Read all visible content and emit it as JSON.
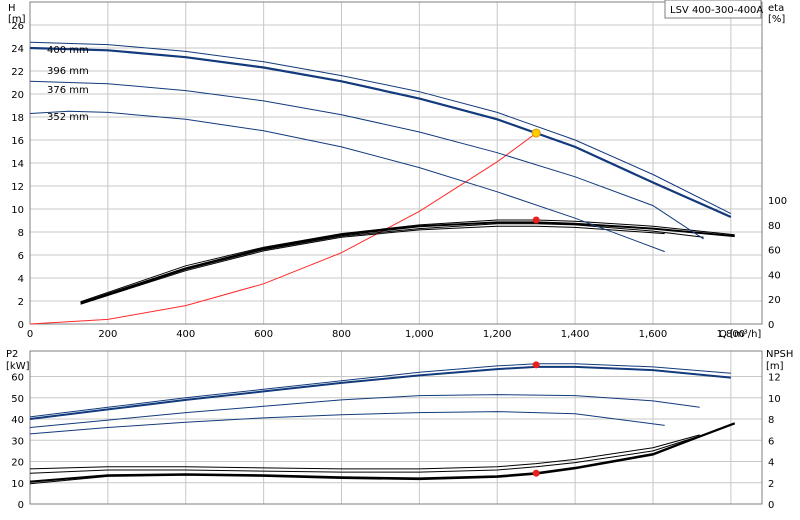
{
  "chart_data": [
    {
      "type": "line",
      "id": "head_eta",
      "title_box": "LSV 400-300-400A",
      "x_label": "Q [m³/h]",
      "x_ticks": [
        0,
        200,
        400,
        600,
        800,
        1000,
        1200,
        1400,
        1600,
        1800
      ],
      "x_tick_labels": [
        "0",
        "200",
        "400",
        "600",
        "800",
        "1,000",
        "1,200",
        "1,400",
        "1,600",
        "1,800"
      ],
      "xlim": [
        0,
        1880
      ],
      "left_axis": {
        "label_top": "H",
        "label_unit": "[m]",
        "ylim": [
          0,
          28
        ],
        "ticks": [
          0,
          2,
          4,
          6,
          8,
          10,
          12,
          14,
          16,
          18,
          20,
          22,
          24,
          26
        ]
      },
      "right_axis": {
        "label_top": "eta",
        "label_unit": "[%]",
        "ylim": [
          0,
          260
        ],
        "ticks": [
          0,
          20,
          40,
          60,
          80,
          100
        ]
      },
      "grid": true,
      "head_curves": [
        {
          "name": "400 mm",
          "x": [
            0,
            200,
            400,
            600,
            800,
            1000,
            1200,
            1400,
            1600,
            1800
          ],
          "y": [
            24.5,
            24.3,
            23.7,
            22.8,
            21.6,
            20.2,
            18.4,
            16.0,
            13.0,
            9.6
          ]
        },
        {
          "name": "396 mm",
          "x": [
            0,
            200,
            400,
            600,
            800,
            1000,
            1200,
            1400,
            1600,
            1800
          ],
          "y": [
            24.0,
            23.8,
            23.2,
            22.3,
            21.1,
            19.6,
            17.8,
            15.4,
            12.3,
            9.3
          ]
        },
        {
          "name": "376 mm",
          "x": [
            0,
            200,
            400,
            600,
            800,
            1000,
            1200,
            1400,
            1600,
            1730
          ],
          "y": [
            21.1,
            20.9,
            20.3,
            19.4,
            18.2,
            16.7,
            14.9,
            12.8,
            10.3,
            7.4
          ]
        },
        {
          "name": "352 mm",
          "x": [
            0,
            100,
            200,
            400,
            600,
            800,
            1000,
            1200,
            1400,
            1630
          ],
          "y": [
            18.3,
            18.5,
            18.4,
            17.8,
            16.8,
            15.4,
            13.6,
            11.5,
            9.2,
            6.3
          ]
        }
      ],
      "selected_head_curve": "396 mm",
      "eta_curves": [
        {
          "x": [
            130,
            400,
            600,
            800,
            1000,
            1200,
            1300,
            1400,
            1600,
            1810
          ],
          "y": [
            18,
            47,
            62,
            73,
            80,
            84,
            84,
            83,
            79,
            72
          ]
        },
        {
          "x": [
            130,
            400,
            600,
            800,
            1000,
            1200,
            1300,
            1400,
            1600,
            1810
          ],
          "y": [
            17,
            45,
            61,
            72,
            79,
            82,
            82,
            81,
            77,
            71
          ]
        },
        {
          "x": [
            130,
            400,
            600,
            800,
            1000,
            1200,
            1300,
            1400,
            1600,
            1730
          ],
          "y": [
            16,
            44,
            60,
            71,
            77,
            81,
            81,
            80,
            75,
            70
          ]
        },
        {
          "x": [
            130,
            400,
            600,
            800,
            1000,
            1200,
            1300,
            1400,
            1630
          ],
          "y": [
            16,
            43,
            59,
            70,
            76,
            79,
            79,
            78,
            73
          ]
        }
      ],
      "system_curve": {
        "x": [
          0,
          200,
          400,
          600,
          800,
          1000,
          1200,
          1300
        ],
        "y": [
          0,
          0.4,
          1.6,
          3.5,
          6.2,
          9.8,
          14.1,
          16.6
        ]
      },
      "duty_point": {
        "x": 1300,
        "y": 16.6
      },
      "eta_point": {
        "x": 1300,
        "y": 84
      },
      "curve_labels": [
        "400 mm",
        "396 mm",
        "376 mm",
        "352 mm"
      ]
    },
    {
      "type": "line",
      "id": "power_npsh",
      "x_ticks": [
        0,
        200,
        400,
        600,
        800,
        1000,
        1200,
        1400,
        1600,
        1800
      ],
      "xlim": [
        0,
        1880
      ],
      "left_axis": {
        "label_top": "P2",
        "label_unit": "[kW]",
        "ylim": [
          0,
          72
        ],
        "ticks": [
          0,
          10,
          20,
          30,
          40,
          50,
          60
        ]
      },
      "right_axis": {
        "label_top": "NPSH",
        "label_unit": "[m]",
        "ylim": [
          0,
          14.4
        ],
        "ticks": [
          0,
          2,
          4,
          6,
          8,
          10,
          12
        ]
      },
      "grid": true,
      "power_curves": [
        {
          "name": "400 mm",
          "x": [
            0,
            200,
            400,
            600,
            800,
            1000,
            1200,
            1300,
            1400,
            1600,
            1800
          ],
          "y": [
            41,
            45.5,
            50,
            54,
            58,
            62,
            65,
            66,
            66,
            64.5,
            61.5
          ]
        },
        {
          "name": "396 mm",
          "x": [
            0,
            200,
            400,
            600,
            800,
            1000,
            1200,
            1300,
            1400,
            1600,
            1800
          ],
          "y": [
            40,
            44.5,
            49,
            53,
            57,
            60.5,
            63.5,
            64.5,
            64.5,
            63,
            59.5
          ]
        },
        {
          "name": "376 mm",
          "x": [
            0,
            200,
            400,
            600,
            800,
            1000,
            1200,
            1400,
            1600,
            1720
          ],
          "y": [
            36,
            39.5,
            43,
            46,
            49,
            51,
            51.5,
            51,
            48.5,
            45.5
          ]
        },
        {
          "name": "352 mm",
          "x": [
            0,
            200,
            400,
            600,
            800,
            1000,
            1200,
            1400,
            1630
          ],
          "y": [
            33,
            36,
            38.5,
            40.5,
            42,
            43,
            43.5,
            42.5,
            37
          ]
        }
      ],
      "npsh_curves": [
        {
          "x": [
            0,
            200,
            400,
            600,
            800,
            1000,
            1200,
            1300,
            1400,
            1600,
            1720
          ],
          "y": [
            3.3,
            3.5,
            3.5,
            3.4,
            3.3,
            3.3,
            3.5,
            3.8,
            4.2,
            5.3,
            6.5
          ]
        },
        {
          "x": [
            0,
            200,
            400,
            600,
            800,
            1000,
            1200,
            1300,
            1400,
            1600,
            1720
          ],
          "y": [
            2.9,
            3.2,
            3.2,
            3.1,
            3.0,
            3.0,
            3.2,
            3.5,
            3.9,
            5.0,
            6.4
          ]
        },
        {
          "x": [
            0,
            200,
            400,
            600,
            800,
            1000,
            1200,
            1300,
            1400,
            1600,
            1810
          ],
          "y": [
            2.1,
            2.7,
            2.8,
            2.7,
            2.5,
            2.4,
            2.6,
            2.9,
            3.4,
            4.7,
            7.6
          ]
        },
        {
          "x": [
            0,
            200,
            400,
            600,
            800,
            1000,
            1200,
            1300,
            1400,
            1600,
            1810
          ],
          "y": [
            1.9,
            2.6,
            2.7,
            2.6,
            2.4,
            2.3,
            2.5,
            2.8,
            3.3,
            4.6,
            7.6
          ]
        }
      ],
      "power_point": {
        "x": 1300,
        "y": 65.5
      },
      "npsh_point": {
        "x": 1300,
        "y": 2.9
      }
    }
  ],
  "colors": {
    "head": "#123a7c",
    "eta": "#000000",
    "system": "#ff2a2a",
    "duty": "#ffcc00",
    "point": "#e8201e",
    "grid": "#c8c8c8",
    "frame": "#7f7f7f"
  }
}
